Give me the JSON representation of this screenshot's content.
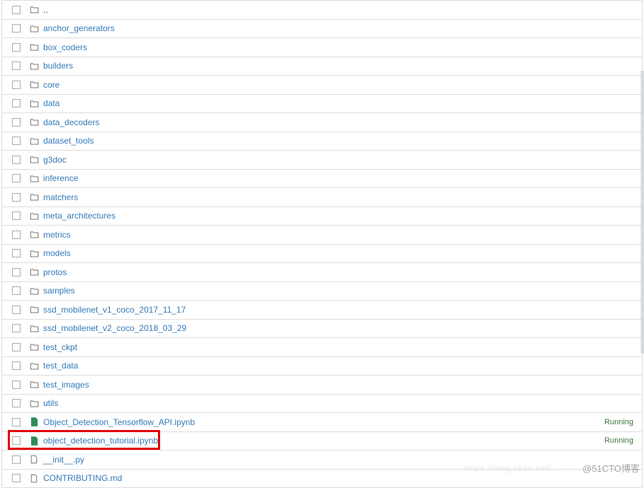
{
  "items": [
    {
      "name": "..",
      "type": "folder",
      "plain": true
    },
    {
      "name": "anchor_generators",
      "type": "folder"
    },
    {
      "name": "box_coders",
      "type": "folder"
    },
    {
      "name": "builders",
      "type": "folder"
    },
    {
      "name": "core",
      "type": "folder"
    },
    {
      "name": "data",
      "type": "folder"
    },
    {
      "name": "data_decoders",
      "type": "folder"
    },
    {
      "name": "dataset_tools",
      "type": "folder"
    },
    {
      "name": "g3doc",
      "type": "folder"
    },
    {
      "name": "inference",
      "type": "folder"
    },
    {
      "name": "matchers",
      "type": "folder"
    },
    {
      "name": "meta_architectures",
      "type": "folder"
    },
    {
      "name": "metrics",
      "type": "folder"
    },
    {
      "name": "models",
      "type": "folder"
    },
    {
      "name": "protos",
      "type": "folder"
    },
    {
      "name": "samples",
      "type": "folder"
    },
    {
      "name": "ssd_mobilenet_v1_coco_2017_11_17",
      "type": "folder"
    },
    {
      "name": "ssd_mobilenet_v2_coco_2018_03_29",
      "type": "folder"
    },
    {
      "name": "test_ckpt",
      "type": "folder"
    },
    {
      "name": "test_data",
      "type": "folder"
    },
    {
      "name": "test_images",
      "type": "folder"
    },
    {
      "name": "utils",
      "type": "folder"
    },
    {
      "name": "Object_Detection_Tensorflow_API.ipynb",
      "type": "notebook",
      "status": "Running"
    },
    {
      "name": "object_detection_tutorial.ipynb",
      "type": "notebook",
      "status": "Running",
      "highlighted": true
    },
    {
      "name": "__init__.py",
      "type": "file"
    },
    {
      "name": "CONTRIBUTING.md",
      "type": "file"
    }
  ],
  "status_label": "Running",
  "watermark": "@51CTO博客",
  "watermark_faint": "https://blog.csdn.net/..."
}
